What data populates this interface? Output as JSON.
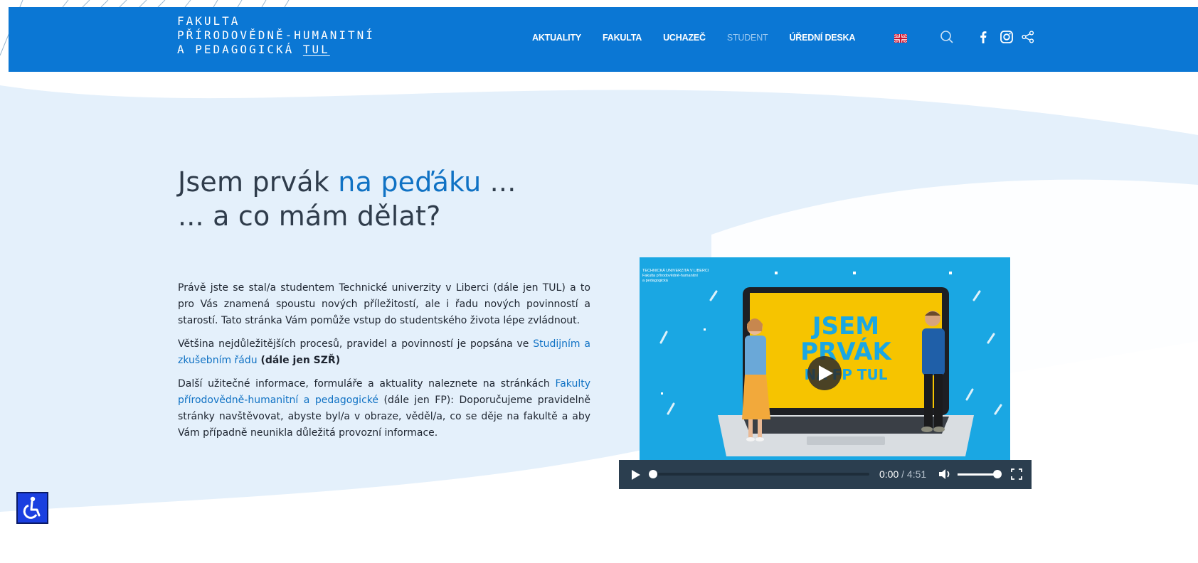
{
  "header": {
    "logo_lines": [
      "FAKULTA",
      "PŘÍRODOVĚDNĚ-HUMANITNÍ",
      "A PEDAGOGICKÁ ",
      "TUL"
    ],
    "nav": [
      "AKTUALITY",
      "FAKULTA",
      "UCHAZEČ",
      "STUDENT",
      "ÚŘEDNÍ DESKA"
    ],
    "icons": [
      "uk-flag-icon",
      "search-icon",
      "facebook-icon",
      "instagram-icon",
      "share-icon"
    ]
  },
  "headline": {
    "part1": "Jsem prvák ",
    "accent": "na peďáku",
    "part2": " ...",
    "line2": "... a co mám dělat?"
  },
  "body": {
    "p1": "Právě jste se stal/a studentem Technické univerzity v Liberci (dále jen TUL) a to pro Vás znamená spoustu nových příležitostí, ale i řadu nových povinností a starostí. Tato stránka Vám pomůže vstup do studentského života lépe zvládnout.",
    "p2_before": "Většina nejdůležitějších procesů, pravidel a povinností je popsána ve ",
    "p2_link": "Studijním a zkušebním řádu",
    "p2_bold": " (dále jen SZŘ)",
    "p3_before": "Další užitečné informace, formuláře a aktuality naleznete na stránkách ",
    "p3_link": "Fakulty přírodovědně-humanitní a pedagogické",
    "p3_after": " (dále jen FP): Doporučujeme pravidelně stránky navštěvovat, abyste byl/a v obraze, věděl/a, co se děje na fakultě a aby Vám případně neunikla důležitá provozní informace."
  },
  "video": {
    "corner_lines": [
      "TECHNICKÁ UNIVERZITA V LIBERCI",
      "Fakulta přírodovědně-humanitní",
      "a pedagogická"
    ],
    "title_lines": [
      "JSEM",
      "PRVÁK",
      "NA FP TUL"
    ],
    "current": "0:00",
    "separator": " / ",
    "duration": "4:51",
    "progress": 0,
    "volume": 1
  },
  "colors": {
    "brand": "#0b77d4",
    "accent_text": "#1072c4",
    "video_bg": "#1aa7e3",
    "video_screen": "#f6c400"
  },
  "accessibility": {
    "icon": "wheelchair-icon"
  }
}
